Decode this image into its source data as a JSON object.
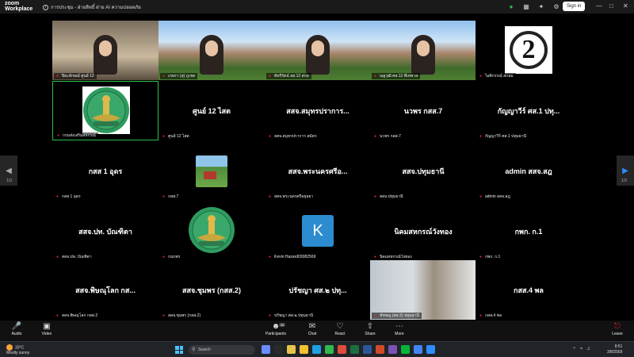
{
  "app": {
    "brand_line1": "zoom",
    "brand_line2": "Workplace"
  },
  "meeting": {
    "title": "การประชุม - ฝ่ายสิทธิ์ ฝ่าย AI ความปลอดภัย"
  },
  "titlebar": {
    "signin_label": "Sign in"
  },
  "tiles": [
    {
      "row": 0,
      "col": 0,
      "type": "video",
      "name": "ปิยะลักษณ์ ศูนย์ 12"
    },
    {
      "row": 0,
      "col": 1,
      "type": "video",
      "name": "เกษรา (สุ) ภูเขต"
    },
    {
      "row": 0,
      "col": 2,
      "type": "video",
      "name": "พัชรีรัตน์ สส.12 สกล"
    },
    {
      "row": 0,
      "col": 3,
      "type": "video",
      "name": "ณฐวุฒิ ศส.12 พี่เทพาส"
    },
    {
      "row": 0,
      "col": 4,
      "type": "logo",
      "name": "ไอศิกรรณ์ สกลม",
      "logo": "2"
    },
    {
      "row": 1,
      "col": 0,
      "type": "seal",
      "name": "กรมส่งเสริมสหกรณ์",
      "active": true
    },
    {
      "row": 1,
      "col": 1,
      "type": "name",
      "big": "ศูนย์ 12 ไสต",
      "name": "ศูนย์ 12 ไสต"
    },
    {
      "row": 1,
      "col": 2,
      "type": "name",
      "big": "สสจ.สมุทรปราการ...",
      "name": "สสจ.สมุทรปราการ สมัคร"
    },
    {
      "row": 1,
      "col": 3,
      "type": "name",
      "big": "นวพร กสส.7",
      "name": "นวพร กสส.7"
    },
    {
      "row": 1,
      "col": 4,
      "type": "name",
      "big": "กัญญาวีร์ ศส.1 ปทุ...",
      "name": "กัญญาวีร์ ศส.1 ปทุมธานี"
    },
    {
      "row": 2,
      "col": 0,
      "type": "name",
      "big": "กสส 1 อุดร",
      "name": "กสส 1 อุดร"
    },
    {
      "row": 2,
      "col": 1,
      "type": "picture",
      "name": "กสส.7"
    },
    {
      "row": 2,
      "col": 2,
      "type": "name",
      "big": "สสจ.พระนครศรีอ...",
      "name": "สสจ.พระนครศรีอยุธยา"
    },
    {
      "row": 2,
      "col": 3,
      "type": "name",
      "big": "สสจ.ปทุมธานี",
      "name": "สสจ.ปทุมธานี"
    },
    {
      "row": 2,
      "col": 4,
      "type": "name",
      "big": "admin สสจ.สฎ",
      "name": "admin สสจ.สฎ"
    },
    {
      "row": 3,
      "col": 0,
      "type": "name",
      "big": "สสจ.ปท. บัณฑิตา",
      "name": "สสจ.ปท. บัณฑิตา"
    },
    {
      "row": 3,
      "col": 1,
      "type": "seal",
      "name": "กนกพร"
    },
    {
      "row": 3,
      "col": 2,
      "type": "initial",
      "initial": "K",
      "name": "Kevin Hazard03082569"
    },
    {
      "row": 3,
      "col": 3,
      "type": "name",
      "big": "นิคมสหกรณ์วังทอง",
      "name": "นิคมสหกรณ์วังทอง"
    },
    {
      "row": 3,
      "col": 4,
      "type": "name",
      "big": "กพก. ก.1",
      "name": "กพก. ก.1"
    },
    {
      "row": 4,
      "col": 0,
      "type": "name",
      "big": "สสจ.พิษณุโลก กส...",
      "name": "สสจ.พิษณุโลก กสส.2"
    },
    {
      "row": 4,
      "col": 1,
      "type": "name",
      "big": "สสจ.ชุมพร (กสส.2)",
      "name": "สสจ.ชุมพร (กสส.2)"
    },
    {
      "row": 4,
      "col": 2,
      "type": "name",
      "big": "ปรัชญา ศส.๒ ปทุ...",
      "name": "ปรัชญา ศส.๒ ปทุมธานี"
    },
    {
      "row": 4,
      "col": 3,
      "type": "video",
      "name": "ชัชชญ (ศส.2) ปทุมธานี"
    },
    {
      "row": 4,
      "col": 4,
      "type": "name",
      "big": "กสส.4 พล",
      "name": "กสส.4 พล"
    }
  ],
  "pager": {
    "left": "1/3",
    "right": "1/3"
  },
  "toolbar": {
    "audio": "Audio",
    "video": "Video",
    "participants": "Participants",
    "participants_count": "25",
    "chat": "Chat",
    "react": "React",
    "share": "Share",
    "more": "More",
    "leave": "Leave"
  },
  "taskbar": {
    "temp": "33°C",
    "weather": "Mostly sunny",
    "search_placeholder": "Search",
    "time": "8:51",
    "date": "3/8/2569"
  }
}
